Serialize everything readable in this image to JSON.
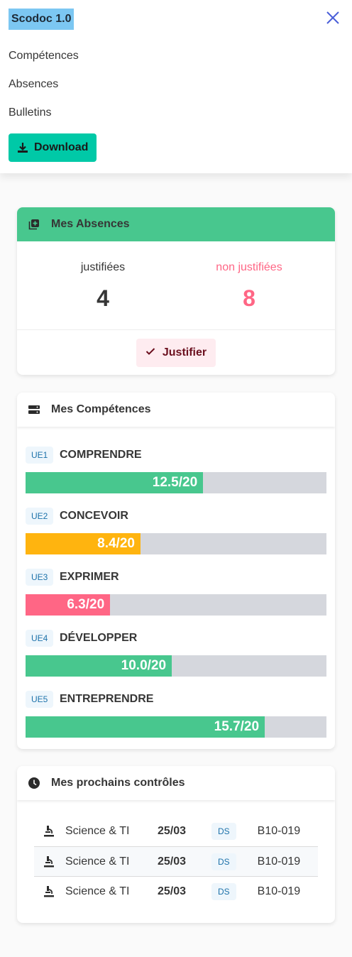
{
  "nav": {
    "brand": "Scodoc 1.0",
    "menu": [
      "Compétences",
      "Absences",
      "Bulletins"
    ],
    "download_label": "Download"
  },
  "absences": {
    "title": "Mes Absences",
    "justified_label": "justifiées",
    "justified_value": "4",
    "unjustified_label": "non justifiées",
    "unjustified_value": "8",
    "justify_label": "Justifier"
  },
  "competences": {
    "title": "Mes Compétences",
    "items": [
      {
        "tag": "UE1",
        "name": "COMPRENDRE",
        "score": "12.5/20",
        "fraction": 0.59,
        "color": "#48c78e"
      },
      {
        "tag": "UE2",
        "name": "CONCEVOIR",
        "score": "8.4/20",
        "fraction": 0.382,
        "color": "#ffb40f"
      },
      {
        "tag": "UE3",
        "name": "EXPRIMER",
        "score": "6.3/20",
        "fraction": 0.281,
        "color": "#ff6685"
      },
      {
        "tag": "UE4",
        "name": "DÉVELOPPER",
        "score": "10.0/20",
        "fraction": 0.486,
        "color": "#48c78e"
      },
      {
        "tag": "UE5",
        "name": "ENTREPRENDRE",
        "score": "15.7/20",
        "fraction": 0.795,
        "color": "#48c78e"
      }
    ]
  },
  "controls": {
    "title": "Mes prochains contrôles",
    "rows": [
      {
        "subject": "Science & TI",
        "date": "25/03",
        "type": "DS",
        "room": "B10-019"
      },
      {
        "subject": "Science & TI",
        "date": "25/03",
        "type": "DS",
        "room": "B10-019"
      },
      {
        "subject": "Science & TI",
        "date": "25/03",
        "type": "DS",
        "room": "B10-019"
      }
    ]
  },
  "colors": {
    "accent": "#00c9a7",
    "success": "#48c78e",
    "danger": "#ff6685",
    "warning": "#ffb40f"
  },
  "icons": {
    "close": "close-icon",
    "download": "download-icon",
    "absences": "square-plus-icon",
    "competences": "server-icon",
    "controls": "clock-icon",
    "control_row": "microscope-icon"
  }
}
